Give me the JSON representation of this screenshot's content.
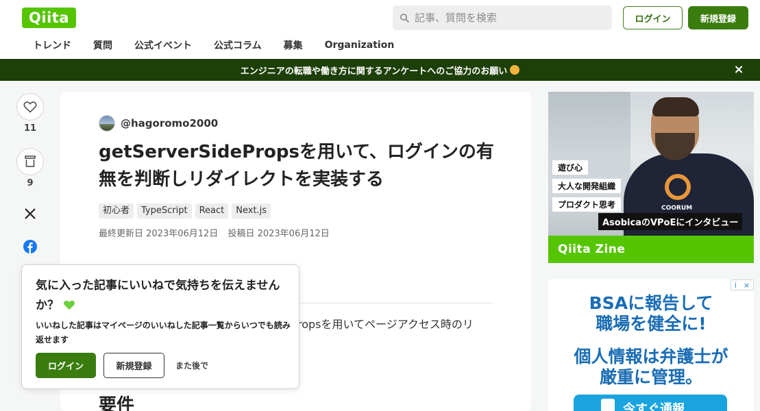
{
  "header": {
    "logo": "Qiita",
    "search_placeholder": "記事、質問を検索",
    "login": "ログイン",
    "signup": "新規登録",
    "nav": [
      "トレンド",
      "質問",
      "公式イベント",
      "公式コラム",
      "募集",
      "Organization"
    ]
  },
  "banner": {
    "text": "エンジニアの転職や働き方に関するアンケートへのご協力のお願い",
    "close": "×"
  },
  "rail": {
    "like_count": "11",
    "stock_count": "9"
  },
  "article": {
    "author": "@hagoromo2000",
    "title": "getServerSidePropsを用いて、ログインの有無を判断しリダイレクトを実装する",
    "tags": [
      "初心者",
      "TypeScript",
      "React",
      "Next.js"
    ],
    "updated": "最終更新日 2023年06月12日",
    "posted": "投稿日 2023年06月12日",
    "body_fragment_line1": "ropsを用いてページアクセス時のリ",
    "heading": "要件"
  },
  "popup": {
    "title": "気に入った記事にいいねで気持ちを伝えませんか？",
    "desc": "いいねした記事はマイページのいいねした記事一覧からいつでも読み返せます",
    "login": "ログイン",
    "signup": "新規登録",
    "later": "また後で"
  },
  "ad1": {
    "tags": [
      "遊び心",
      "大人な開発組織",
      "プロダクト思考"
    ],
    "tagline": "AsobicaのVPoEにインタビュー",
    "shirt_text": "COORUM",
    "footer": "Qiita Zine"
  },
  "ad2": {
    "line1a": "BSAに報告して",
    "line1b": "職場を健全に!",
    "line2a": "個人情報は弁護士が",
    "line2b": "厳重に管理。",
    "cta": "今すぐ通報",
    "adchoice_i": "i",
    "adchoice_x": "×"
  },
  "colors": {
    "brand": "#55c500",
    "brand_dark": "#3a7d0e",
    "banner": "#1d3f08",
    "ad_blue": "#1a6db5"
  },
  "icons": [
    "search-icon",
    "close-icon",
    "heart-icon",
    "stock-icon",
    "x-icon",
    "facebook-icon",
    "green-heart-emoji"
  ]
}
